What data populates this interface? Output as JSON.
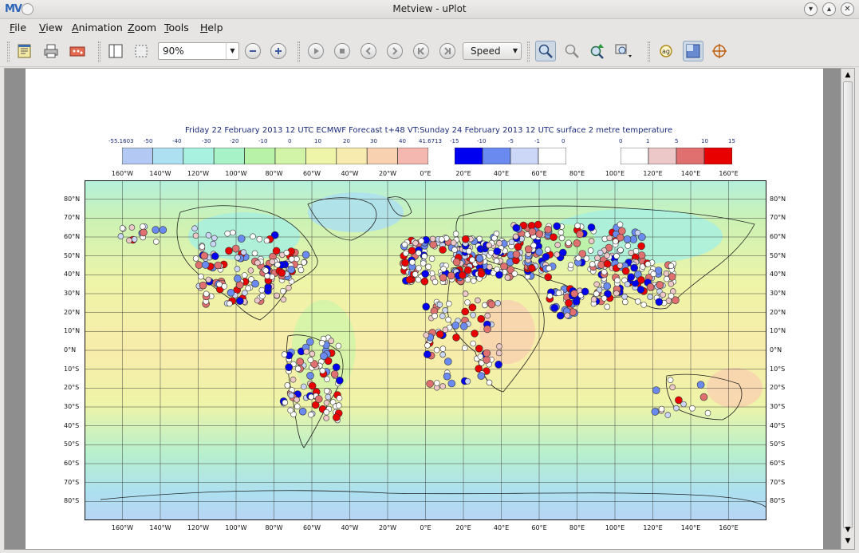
{
  "window": {
    "title": "Metview - uPlot",
    "logo_text": "MV"
  },
  "menu": [
    {
      "label": "File",
      "key": "F",
      "rest": "ile"
    },
    {
      "label": "View",
      "key": "V",
      "rest": "iew"
    },
    {
      "label": "Animation",
      "key": "A",
      "rest": "nimation"
    },
    {
      "label": "Zoom",
      "key": "Z",
      "rest": "oom"
    },
    {
      "label": "Tools",
      "key": "T",
      "rest": "ools"
    },
    {
      "label": "Help",
      "key": "H",
      "rest": "elp"
    }
  ],
  "toolbar": {
    "zoom_level": "90%",
    "speed_label": "Speed",
    "buttons": [
      "export-icon",
      "print-icon",
      "save-image-icon",
      "sidebar-icon",
      "select-icon",
      "zoom-out-icon",
      "zoom-in-icon",
      "play-icon",
      "stop-icon",
      "previous-icon",
      "next-icon",
      "first-frame-icon",
      "last-frame-icon",
      "zoom-tool-icon",
      "zoom-stack-icon",
      "zoom-up-icon",
      "zoom-area-icon",
      "magnifier-icon",
      "layers-icon",
      "cursor-data-icon"
    ]
  },
  "plot": {
    "title": "Friday 22 February 2013 12 UTC ECMWF Forecast t+48 VT:Sunday 24 February 2013 12 UTC surface  2 metre temperature",
    "legend_field": {
      "ticks": [
        "-55.1603",
        "-50",
        "-40",
        "-30",
        "-20",
        "-10",
        "0",
        "10",
        "20",
        "30",
        "40",
        "41.6713"
      ],
      "colors": [
        "#b3c8f2",
        "#ade0f0",
        "#a8f0e0",
        "#a8f2c8",
        "#b8f2a8",
        "#d2f4a8",
        "#eef4a8",
        "#f8ebb0",
        "#f8d2b0",
        "#f4b8b0"
      ]
    },
    "legend_cold": {
      "ticks": [
        "-15",
        "-10",
        "-5",
        "-1",
        "0"
      ],
      "colors": [
        "#0000f0",
        "#6a8af0",
        "#ccd6f6",
        "#ffffff"
      ]
    },
    "legend_warm": {
      "ticks": [
        "0",
        "1",
        "5",
        "10",
        "15"
      ],
      "colors": [
        "#ffffff",
        "#ecc8c8",
        "#e07070",
        "#e80000"
      ]
    },
    "lon_labels": [
      "160°W",
      "140°W",
      "120°W",
      "100°W",
      "80°W",
      "60°W",
      "40°W",
      "20°W",
      "0°E",
      "20°E",
      "40°E",
      "60°E",
      "80°E",
      "100°E",
      "120°E",
      "140°E",
      "160°E"
    ],
    "lat_labels": [
      "80°N",
      "70°N",
      "60°N",
      "50°N",
      "40°N",
      "30°N",
      "20°N",
      "10°N",
      "0°N",
      "10°S",
      "20°S",
      "30°S",
      "40°S",
      "50°S",
      "60°S",
      "70°S",
      "80°S"
    ]
  }
}
